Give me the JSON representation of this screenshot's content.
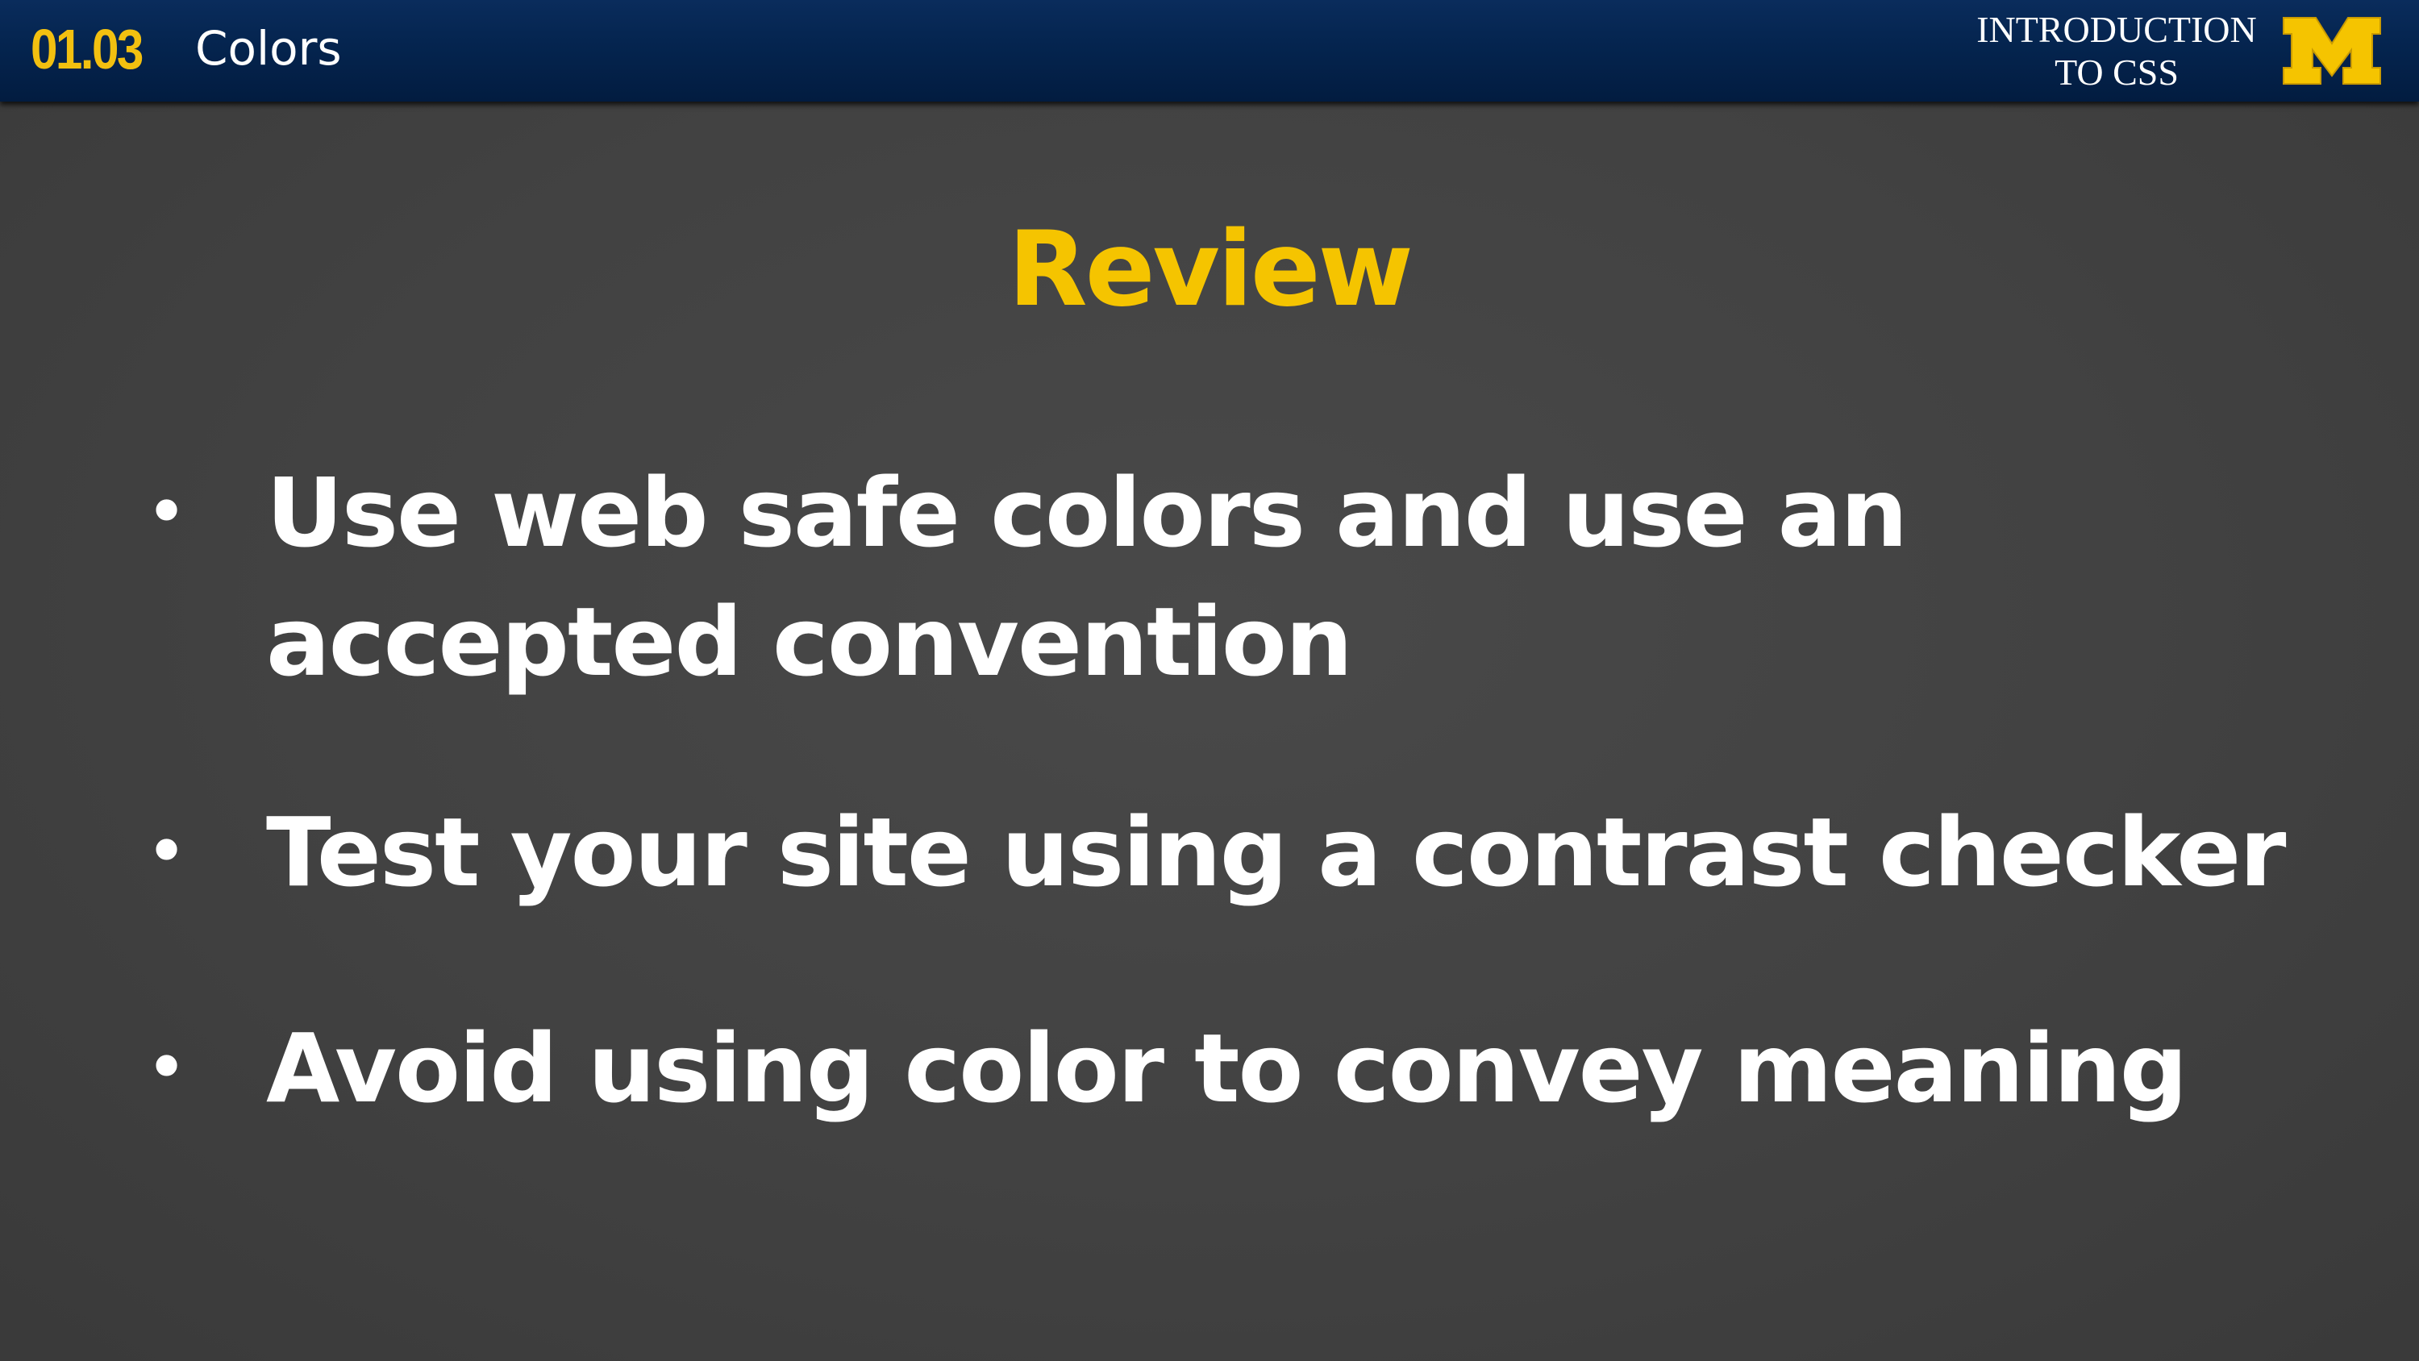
{
  "header": {
    "lesson_number": "01.03",
    "lesson_title": "Colors",
    "course_title_line1": "INTRODUCTION",
    "course_title_line2": "TO CSS",
    "logo_icon": "block-m-logo-icon"
  },
  "slide": {
    "heading": "Review",
    "bullets": [
      {
        "text": "Use web safe colors and use an accepted convention"
      },
      {
        "text": "Test your site using a contrast checker"
      },
      {
        "text": "Avoid using color to convey meaning"
      }
    ]
  },
  "colors": {
    "header_background": "#052550",
    "accent": "#f5c400",
    "slide_background": "#434343",
    "text": "#ffffff"
  }
}
